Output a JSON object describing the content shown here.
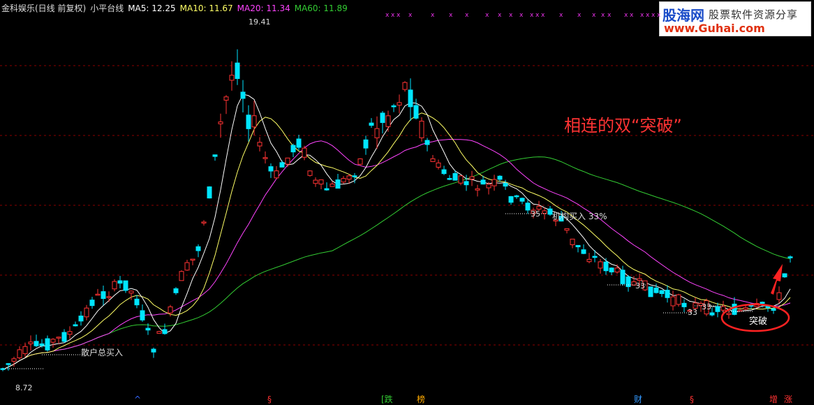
{
  "header": {
    "stock_name": "金科娱乐(日线 前复权)",
    "indicator_name": "小平台线",
    "ma5": "MA5: 12.25",
    "ma10": "MA10: 11.67",
    "ma20": "MA20: 11.34",
    "ma60": "MA60: 11.89"
  },
  "watermark": {
    "line1_brand": "股海网",
    "line1_text": "股票软件资源分享",
    "line2_url": "www.Guhai.com"
  },
  "annotations": {
    "big_caption": "相连的双“突破”",
    "high_label": "19.41",
    "low_label": "8.72",
    "retail_label": "散户总买入",
    "inst_label": "机构买入 33%",
    "n35": "35",
    "n33a": "33",
    "n33b": "33",
    "n33c": "33",
    "breakout_label": "突破"
  },
  "bottom_markers": [
    "^",
    "§",
    "[跌",
    "榜",
    "财",
    "§",
    "增",
    "涨"
  ],
  "colors": {
    "background": "#000000",
    "up_candle": "#ff3333",
    "down_candle": "#00e5ff",
    "ma5": "#ffffff",
    "ma10": "#ffff66",
    "ma20": "#ff44ff",
    "ma60": "#33cc33",
    "grid": "#8b0000",
    "caption": "#ff3333"
  },
  "chart_data": {
    "type": "candlestick",
    "price_range": [
      8.72,
      19.41
    ],
    "high": 19.41,
    "low": 8.72,
    "series": [
      {
        "name": "MA5",
        "value": 12.25
      },
      {
        "name": "MA10",
        "value": 11.67
      },
      {
        "name": "MA20",
        "value": 11.34
      },
      {
        "name": "MA60",
        "value": 11.89
      }
    ]
  }
}
